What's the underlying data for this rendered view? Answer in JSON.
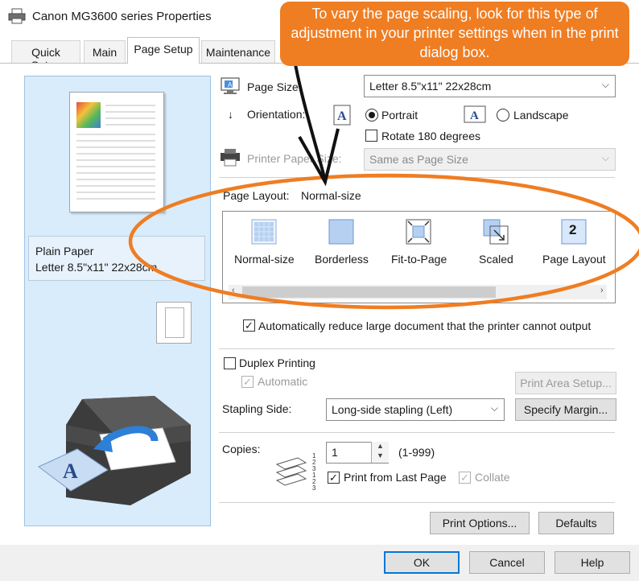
{
  "window": {
    "title": "Canon MG3600 series Properties",
    "close_glyph": "×",
    "icon": "printer-icon"
  },
  "tabs": [
    {
      "label": "Quick Setup"
    },
    {
      "label": "Main"
    },
    {
      "label": "Page Setup",
      "active": true
    },
    {
      "label": "Maintenance"
    }
  ],
  "preview": {
    "paper_type": "Plain Paper",
    "paper_size": "Letter 8.5\"x11\" 22x28cm"
  },
  "page_size": {
    "label": "Page Size:",
    "value": "Letter 8.5\"x11\" 22x28cm"
  },
  "orientation": {
    "label": "Orientation:",
    "portrait": "Portrait",
    "landscape": "Landscape",
    "selected": "Portrait",
    "rotate_label": "Rotate 180 degrees",
    "rotate_checked": false
  },
  "printer_paper_size": {
    "label": "Printer Paper Size:",
    "value": "Same as Page Size",
    "disabled": true
  },
  "page_layout": {
    "label": "Page Layout:",
    "value": "Normal-size",
    "options": [
      {
        "label": "Normal-size",
        "icon": "normal-size-icon"
      },
      {
        "label": "Borderless",
        "icon": "borderless-icon"
      },
      {
        "label": "Fit-to-Page",
        "icon": "fit-to-page-icon"
      },
      {
        "label": "Scaled",
        "icon": "scaled-icon"
      },
      {
        "label": "Page Layout",
        "icon": "page-layout-icon"
      }
    ],
    "layout_icon_digit": "2"
  },
  "auto_reduce": {
    "label": "Automatically reduce large document that the printer cannot output",
    "checked": true
  },
  "duplex": {
    "label": "Duplex Printing",
    "checked": false,
    "automatic_label": "Automatic",
    "automatic_checked": true,
    "automatic_disabled": true,
    "print_area_setup": "Print Area Setup..."
  },
  "stapling": {
    "label": "Stapling Side:",
    "value": "Long-side stapling (Left)",
    "specify_margin": "Specify Margin..."
  },
  "copies": {
    "label": "Copies:",
    "value": "1",
    "range": "(1-999)",
    "print_from_last_label": "Print from Last Page",
    "print_from_last_checked": true,
    "collate_label": "Collate",
    "collate_checked": true,
    "collate_disabled": true,
    "stack_numbers": "1 2 3 1 2 3"
  },
  "buttons": {
    "print_options": "Print Options...",
    "defaults": "Defaults",
    "ok": "OK",
    "cancel": "Cancel",
    "help": "Help"
  },
  "annotation": {
    "callout_text": "To vary the page scaling, look for this type of adjustment in your printer settings when in the print dialog box.",
    "color": "#ef7d22"
  },
  "colors": {
    "preview_bg": "#d9ecfb",
    "accent_blue": "#0078d7",
    "callout_orange": "#ef7d22"
  }
}
